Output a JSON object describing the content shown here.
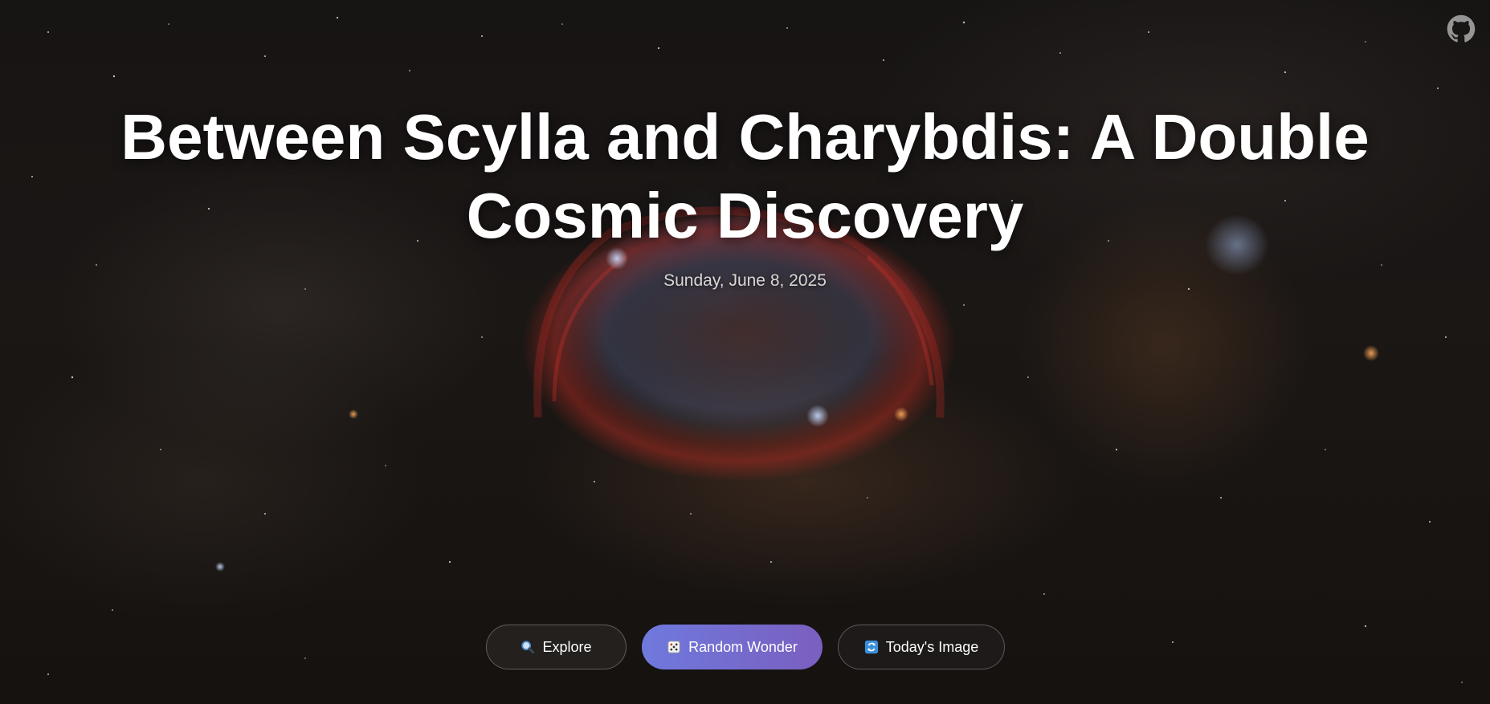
{
  "hero": {
    "title": "Between Scylla and Charybdis: A Double Cosmic Discovery",
    "date": "Sunday, June 8, 2025"
  },
  "header": {
    "github_icon": "github-icon"
  },
  "actions": [
    {
      "label": "Explore",
      "icon": "search-icon"
    },
    {
      "label": "Random Wonder",
      "icon": "dice-icon"
    },
    {
      "label": "Today's Image",
      "icon": "refresh-icon"
    }
  ],
  "colors": {
    "random_gradient_start": "#6f79dd",
    "random_gradient_end": "#7a5fbf",
    "title": "#ffffff",
    "date": "#d9d6d4"
  }
}
